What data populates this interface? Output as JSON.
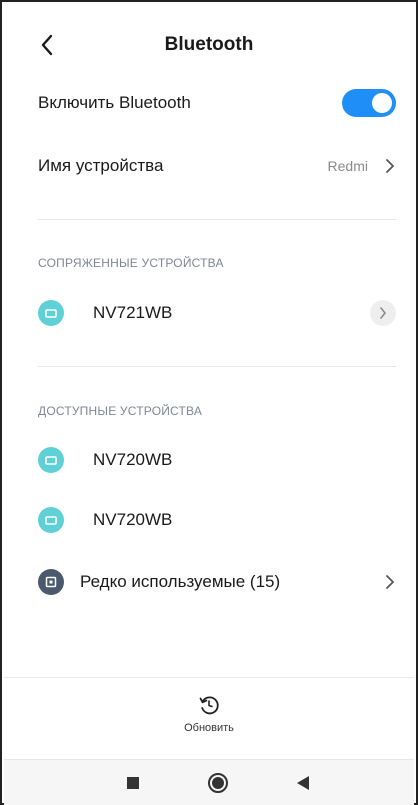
{
  "header": {
    "title": "Bluetooth",
    "back_icon": "chevron-left-icon"
  },
  "settings": {
    "enable_label": "Включить Bluetooth",
    "enable_state": true,
    "device_name_label": "Имя устройства",
    "device_name_value": "Redmi"
  },
  "paired": {
    "section_title": "СОПРЯЖЕННЫЕ УСТРОЙСТВА",
    "devices": [
      {
        "name": "NV721WB",
        "icon": "device-icon"
      }
    ]
  },
  "available": {
    "section_title": "ДОСТУПНЫЕ УСТРОЙСТВА",
    "devices": [
      {
        "name": "NV720WB",
        "icon": "device-icon"
      },
      {
        "name": "NV720WB",
        "icon": "device-icon"
      }
    ],
    "rarely_used_label": "Редко используемые (15)"
  },
  "footer": {
    "refresh_label": "Обновить",
    "refresh_icon": "refresh-icon"
  },
  "nav": {
    "recents_icon": "square-icon",
    "home_icon": "circle-icon",
    "back_icon": "triangle-back-icon"
  },
  "colors": {
    "accent": "#1f8ff7",
    "device_icon_teal": "#5fd0d6",
    "device_icon_gray": "#4a596d",
    "section_text": "#7f8694"
  }
}
